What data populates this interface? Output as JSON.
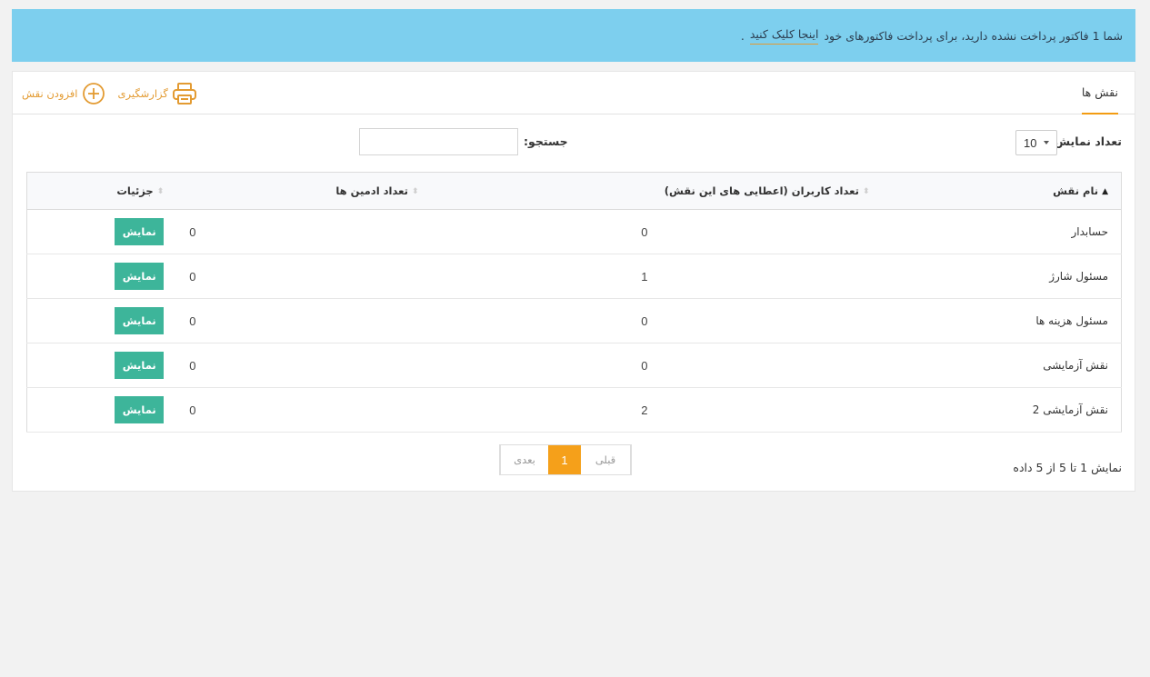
{
  "alert": {
    "text": "شما 1 فاکتور پرداخت نشده دارید، برای پرداخت فاکتورهای خود",
    "link": "اینجا کلیک کنید",
    "tail": "."
  },
  "panel": {
    "tab_title": "نقش ها",
    "report_label": "گزارشگیری",
    "add_label": "افزودن نقش"
  },
  "controls": {
    "length_label": "تعداد نمایش",
    "length_value": "10",
    "search_label": "جستجو:",
    "search_value": ""
  },
  "table": {
    "columns": [
      "نام نقش",
      "تعداد کاربران (اعطایی های این نقش)",
      "تعداد ادمین ها",
      "جزئیات"
    ],
    "rows": [
      {
        "name": "حسابدار",
        "users": "0",
        "admins": "0",
        "action": "نمایش"
      },
      {
        "name": "مسئول شارژ",
        "users": "1",
        "admins": "0",
        "action": "نمایش"
      },
      {
        "name": "مسئول هزینه ها",
        "users": "0",
        "admins": "0",
        "action": "نمایش"
      },
      {
        "name": "نقش آزمایشی",
        "users": "0",
        "admins": "0",
        "action": "نمایش"
      },
      {
        "name": "نقش آزمایشی 2",
        "users": "2",
        "admins": "0",
        "action": "نمایش"
      }
    ]
  },
  "footer": {
    "info": "نمایش 1 تا 5 از 5 داده",
    "prev": "قبلی",
    "current_page": "1",
    "next": "بعدی"
  },
  "colors": {
    "alert_bg": "#7dcfee",
    "accent": "#f39c12",
    "button": "#3db59a"
  }
}
